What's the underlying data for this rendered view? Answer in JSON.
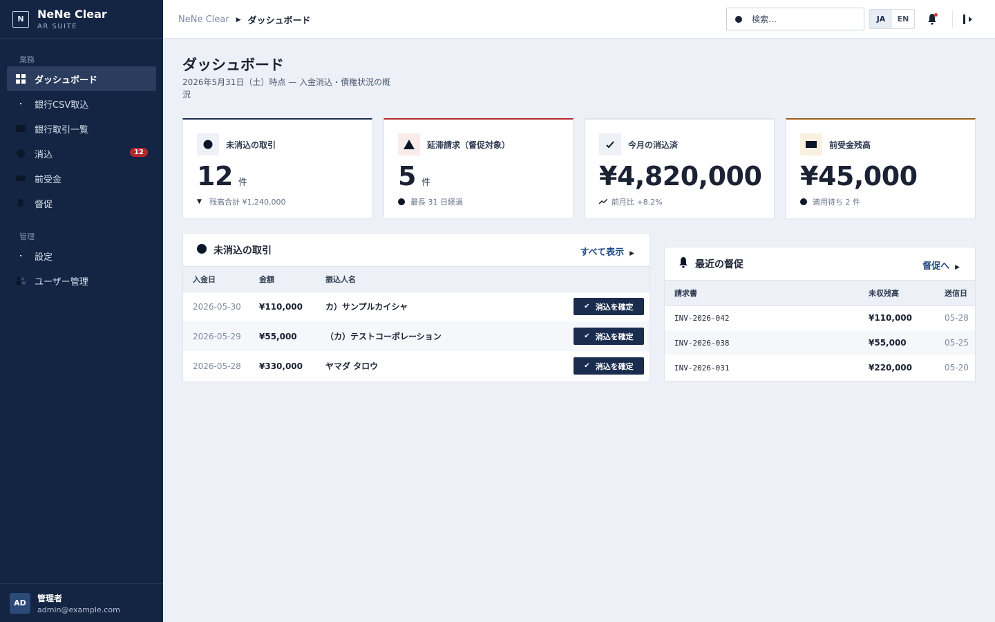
{
  "brand": {
    "logo": "N",
    "name": "NeNe Clear",
    "sub": "AR SUITE"
  },
  "sidebar": {
    "section_ops": "業務",
    "section_admin": "管理",
    "items": [
      {
        "label": "ダッシュボード",
        "icon": "grid-icon"
      },
      {
        "label": "銀行CSV取込",
        "icon": "upload-icon"
      },
      {
        "label": "銀行取引一覧",
        "icon": "list-icon"
      },
      {
        "label": "消込",
        "icon": "match-icon",
        "badge": "12"
      },
      {
        "label": "前受金",
        "icon": "wallet-icon"
      },
      {
        "label": "督促",
        "icon": "bell-icon"
      },
      {
        "label": "設定",
        "icon": "gear-icon"
      },
      {
        "label": "ユーザー管理",
        "icon": "users-icon"
      }
    ],
    "user": {
      "initials": "AD",
      "name": "管理者",
      "email": "admin@example.com"
    }
  },
  "topbar": {
    "crumb_root": "NeNe Clear",
    "crumb_current": "ダッシュボード",
    "search_placeholder": "検索…",
    "lang_ja": "JA",
    "lang_en": "EN"
  },
  "page": {
    "title": "ダッシュボード",
    "subtitle": "2026年5月31日（土）時点 — 入金消込・債権状況の概況"
  },
  "kpis": [
    {
      "label": "未消込の取引",
      "value": "12",
      "unit": "件",
      "note": "残高合計 ¥1,240,000",
      "accent": "#1b2d4f"
    },
    {
      "label": "延滞請求（督促対象）",
      "value": "5",
      "unit": "件",
      "note": "最長 31 日経過",
      "accent": "#b3282d"
    },
    {
      "label": "今月の消込済",
      "value": "¥4,820,000",
      "unit": "",
      "note": "前月比 +8.2%",
      "accent": "#dfe4ec"
    },
    {
      "label": "前受金残高",
      "value": "¥45,000",
      "unit": "",
      "note": "適用待ち 2 件",
      "accent": "#9a5b12"
    }
  ],
  "unmatched": {
    "title": "未消込の取引",
    "link": "すべて表示",
    "headers": [
      "入金日",
      "金額",
      "振込人名"
    ],
    "action_label": "消込を確定",
    "rows": [
      {
        "date": "2026-05-30",
        "amount": "¥110,000",
        "payer": "カ）サンプルカイシャ"
      },
      {
        "date": "2026-05-29",
        "amount": "¥55,000",
        "payer": "（カ）テストコーポレーション"
      },
      {
        "date": "2026-05-28",
        "amount": "¥330,000",
        "payer": "ヤマダ タロウ"
      }
    ]
  },
  "dunning": {
    "title": "最近の督促",
    "link": "督促へ",
    "headers": [
      "請求書",
      "未収残高",
      "送信日"
    ],
    "rows": [
      {
        "invoice": "INV-2026-042",
        "balance": "¥110,000",
        "sent": "05-28"
      },
      {
        "invoice": "INV-2026-038",
        "balance": "¥55,000",
        "sent": "05-25"
      },
      {
        "invoice": "INV-2026-031",
        "balance": "¥220,000",
        "sent": "05-20"
      }
    ]
  }
}
